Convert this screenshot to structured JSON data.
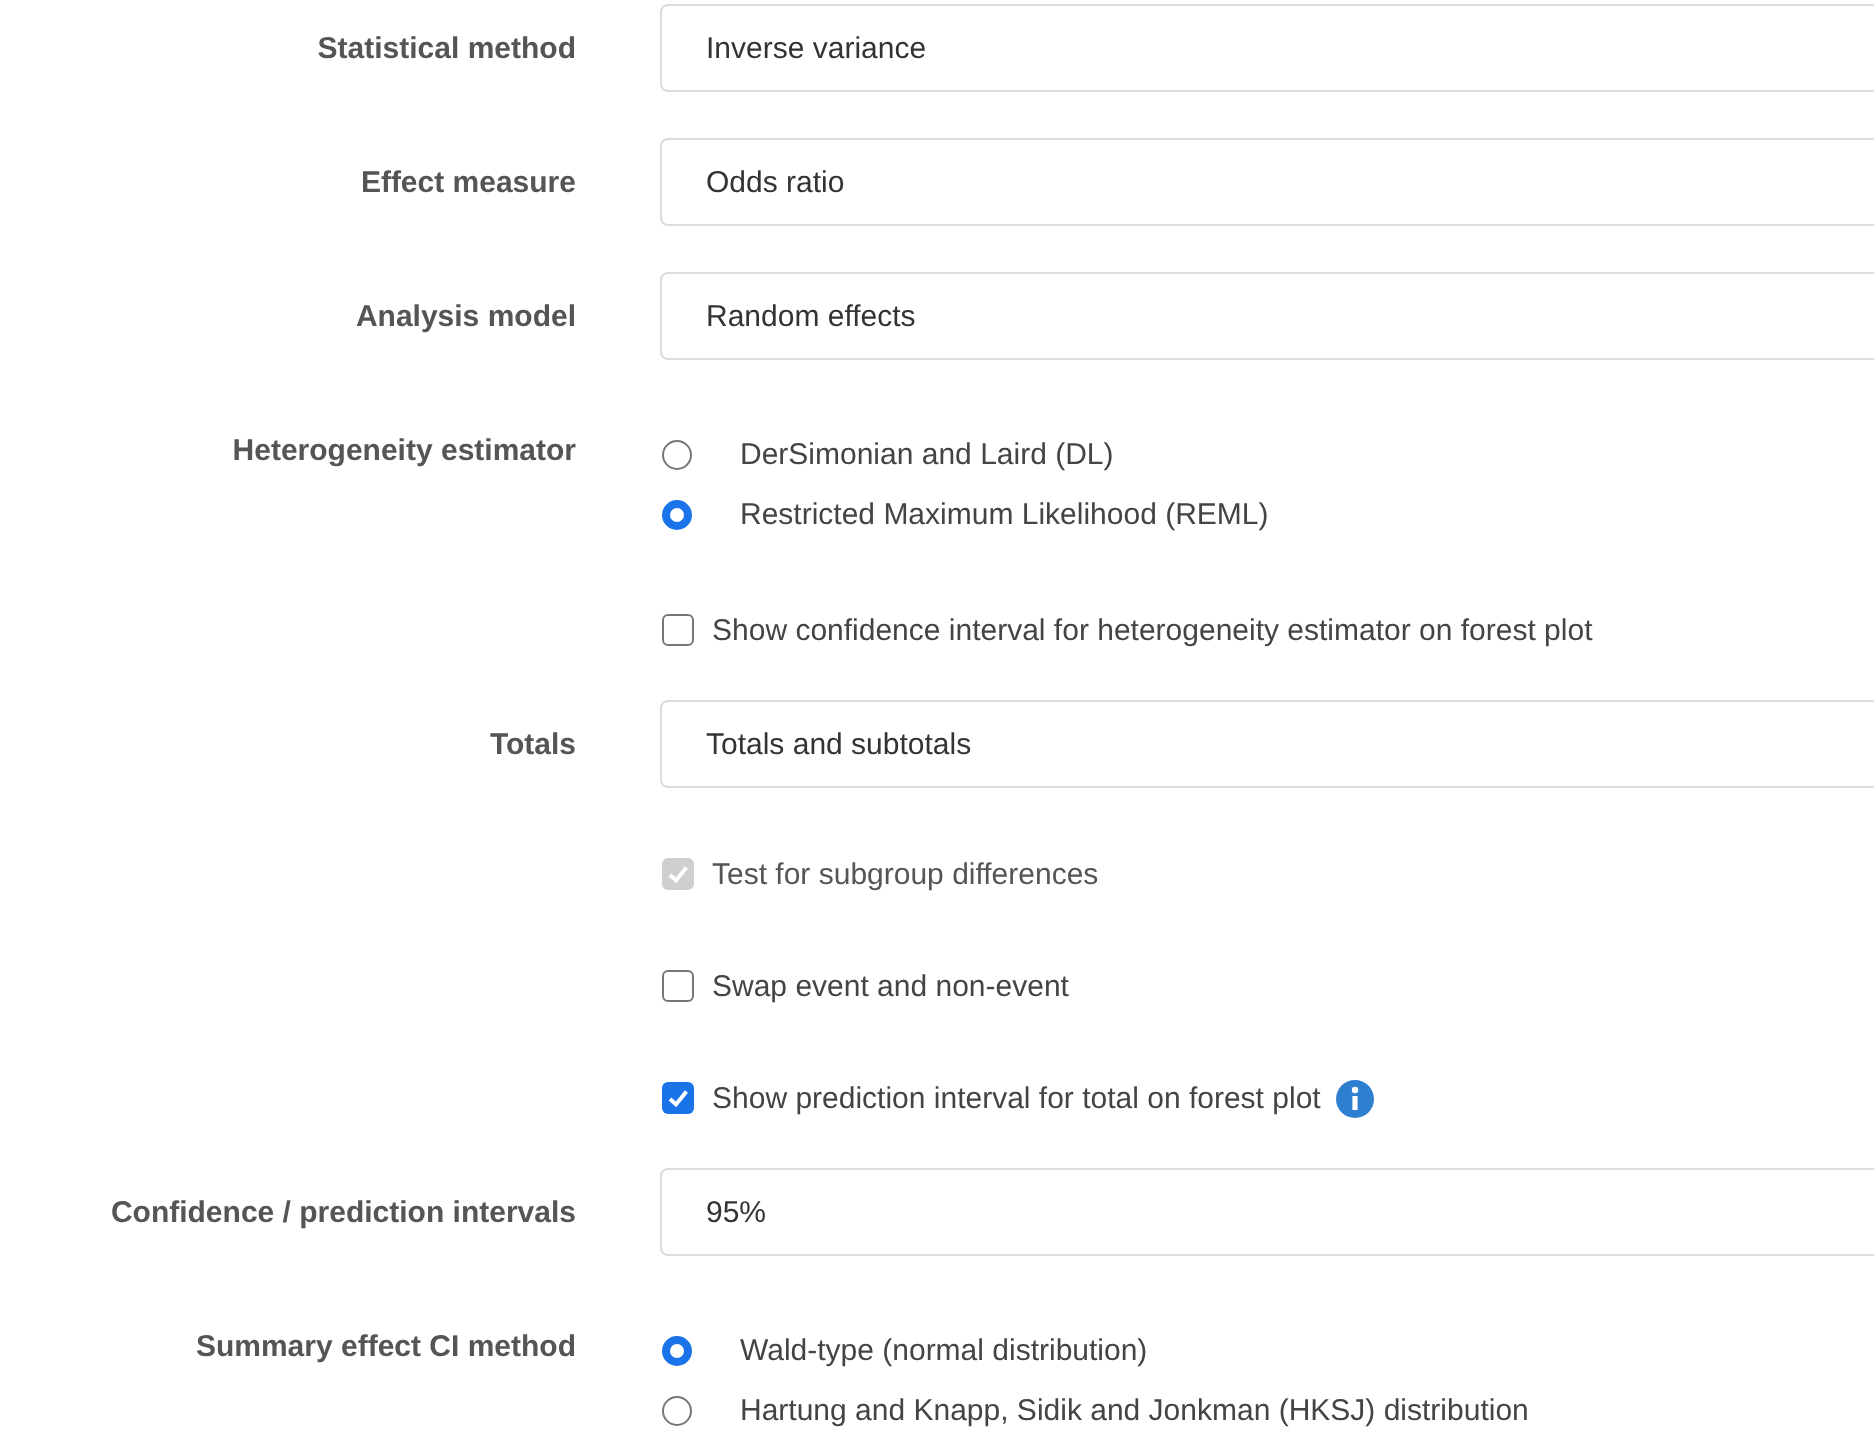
{
  "rows": [
    {
      "kind": "select",
      "label": "Statistical method",
      "value": "Inverse variance"
    },
    {
      "kind": "select",
      "label": "Effect measure",
      "value": "Odds ratio"
    },
    {
      "kind": "select",
      "label": "Analysis model",
      "value": "Random effects"
    },
    {
      "kind": "radio",
      "label": "Heterogeneity estimator",
      "options": [
        {
          "text": "DerSimonian and Laird (DL)",
          "selected": false
        },
        {
          "text": "Restricted Maximum Likelihood (REML)",
          "selected": true
        }
      ]
    },
    {
      "kind": "checkbox",
      "text": "Show confidence interval for heterogeneity estimator on forest plot",
      "checked": false,
      "disabled": false,
      "info": false
    },
    {
      "kind": "select",
      "label": "Totals",
      "value": "Totals and subtotals"
    },
    {
      "kind": "checkbox",
      "text": "Test for subgroup differences",
      "checked": true,
      "disabled": true,
      "info": false
    },
    {
      "kind": "checkbox",
      "text": "Swap event and non-event",
      "checked": false,
      "disabled": false,
      "info": false
    },
    {
      "kind": "checkbox",
      "text": "Show prediction interval for total on forest plot",
      "checked": true,
      "disabled": false,
      "info": true
    },
    {
      "kind": "select",
      "label": "Confidence / prediction intervals",
      "value": "95%"
    },
    {
      "kind": "radio",
      "label": "Summary effect CI method",
      "options": [
        {
          "text": "Wald-type (normal distribution)",
          "selected": true
        },
        {
          "text": "Hartung and Knapp, Sidik and Jonkman (HKSJ) distribution",
          "selected": false
        }
      ]
    }
  ]
}
